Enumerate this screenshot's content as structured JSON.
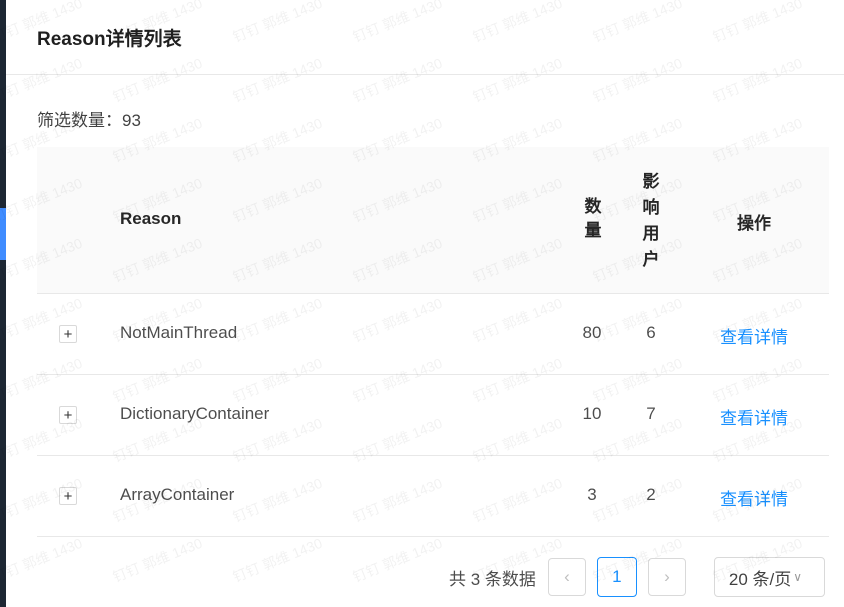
{
  "modal": {
    "title": "Reason详情列表"
  },
  "filter": {
    "label": "筛选数量：",
    "count": "93"
  },
  "table": {
    "headers": {
      "reason": "Reason",
      "count": "数量",
      "users": "影响用户",
      "action": "操作"
    },
    "rows": [
      {
        "expand": "+",
        "reason": "NotMainThread",
        "count": "80",
        "users": "6",
        "action": "查看详情"
      },
      {
        "expand": "+",
        "reason": "DictionaryContainer",
        "count": "10",
        "users": "7",
        "action": "查看详情"
      },
      {
        "expand": "+",
        "reason": "ArrayContainer",
        "count": "3",
        "users": "2",
        "action": "查看详情"
      }
    ]
  },
  "pagination": {
    "total_text": "共 3 条数据",
    "prev_icon": "‹",
    "current_page": "1",
    "next_icon": "›",
    "page_size": "20 条/页"
  },
  "watermark": {
    "text": "钉钉  郭维 1430"
  },
  "colors": {
    "link": "#1890ff",
    "header_bg": "#fafafa",
    "sidebar": "#1d2733",
    "sidebar_accent": "#3f8cff"
  }
}
